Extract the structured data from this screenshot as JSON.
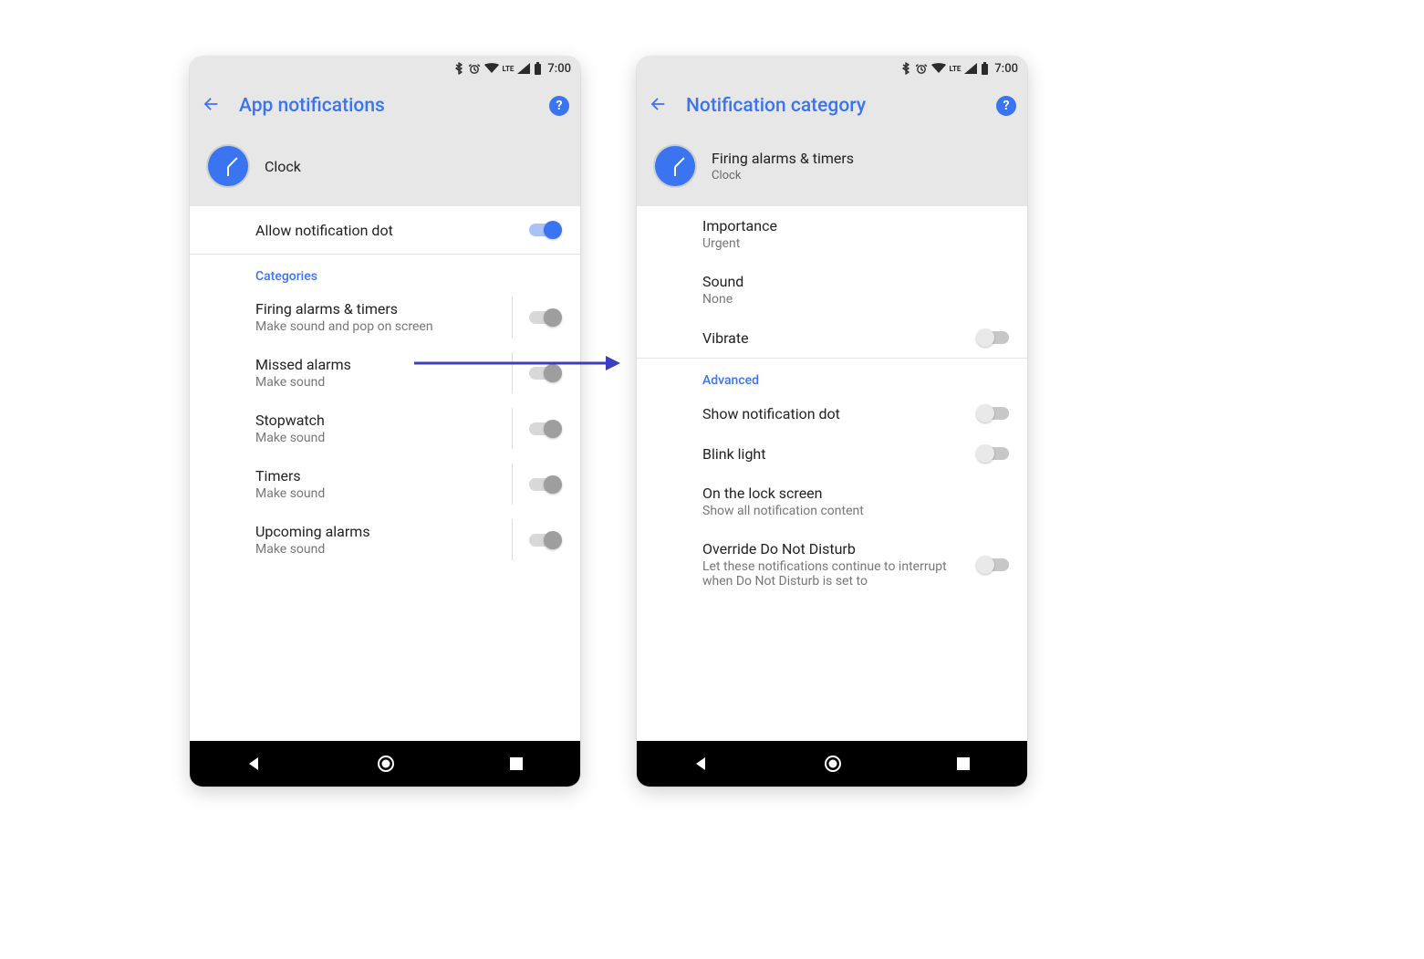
{
  "status": {
    "time": "7:00",
    "lte": "LTE"
  },
  "left": {
    "title": "App notifications",
    "app_name": "Clock",
    "allow_dot": {
      "title": "Allow notification dot",
      "on": true
    },
    "categories_header": "Categories",
    "categories": [
      {
        "title": "Firing alarms & timers",
        "sub": "Make sound and pop on screen"
      },
      {
        "title": "Missed alarms",
        "sub": "Make sound"
      },
      {
        "title": "Stopwatch",
        "sub": "Make sound"
      },
      {
        "title": "Timers",
        "sub": "Make sound"
      },
      {
        "title": "Upcoming alarms",
        "sub": "Make sound"
      }
    ]
  },
  "right": {
    "title": "Notification category",
    "channel_name": "Firing alarms & timers",
    "app_name": "Clock",
    "importance": {
      "title": "Importance",
      "value": "Urgent"
    },
    "sound": {
      "title": "Sound",
      "value": "None"
    },
    "vibrate": {
      "title": "Vibrate"
    },
    "advanced_header": "Advanced",
    "show_dot": {
      "title": "Show notification dot"
    },
    "blink": {
      "title": "Blink light"
    },
    "lock": {
      "title": "On the lock screen",
      "value": "Show all notification content"
    },
    "dnd": {
      "title": "Override Do Not Disturb",
      "sub": "Let these notifications continue to interrupt when Do Not Disturb is set to"
    }
  },
  "colors": {
    "accent": "#3a74f0",
    "arrow": "#3b3fbf"
  }
}
